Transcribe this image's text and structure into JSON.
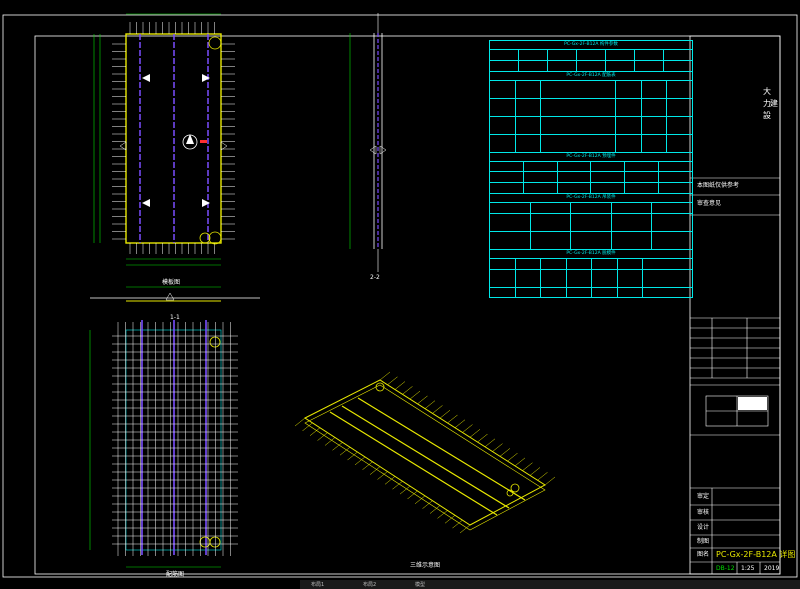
{
  "title_block": {
    "company_lines": [
      "大",
      "力",
      "建",
      "設"
    ],
    "project_note": "本图纸仅供参考",
    "drawing_title": "PC-Gx-2F-B12A 详图",
    "sheet_no": "DB-12",
    "date": "2019",
    "approve_label": "审定",
    "check_label": "审核",
    "design_label": "设计",
    "draw_label": "制图",
    "name_label": "图名",
    "scale_value": "1:25",
    "review_label": "审查意见"
  },
  "tables": {
    "title_1": "PC-Gx-2F-B12A 构件参数",
    "title_2": "PC-Gx-2F-B12A 配筋表",
    "title_3": "PC-Gx-2F-B12A 预埋件",
    "title_4": "PC-Gx-2F-B12A 吊装件",
    "title_5": "PC-Gx-2F-B12A 脱模件"
  },
  "views": {
    "plan_label": "模板图",
    "reinforce_label": "配筋图",
    "iso_label": "三维示意图",
    "section_1": "1-1",
    "section_2": "2-2"
  },
  "taskbar": {
    "tab_1": "布局1",
    "tab_2": "布局2",
    "tab_3": "模型"
  }
}
